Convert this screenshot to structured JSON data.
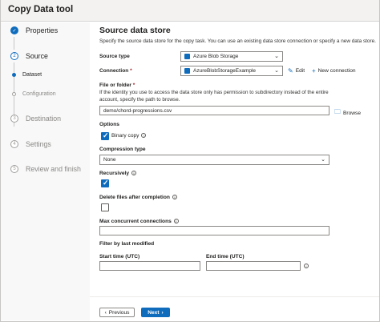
{
  "window": {
    "title": "Copy Data tool"
  },
  "sidebar": {
    "steps": [
      {
        "label": "Properties",
        "number": "",
        "state": "done"
      },
      {
        "label": "Source",
        "number": "2",
        "state": "active"
      },
      {
        "label": "Destination",
        "number": "3",
        "state": "inactive"
      },
      {
        "label": "Settings",
        "number": "4",
        "state": "inactive"
      },
      {
        "label": "Review and finish",
        "number": "5",
        "state": "inactive"
      }
    ],
    "substeps": [
      {
        "label": "Dataset",
        "state": "active"
      },
      {
        "label": "Configuration",
        "state": "inactive"
      }
    ]
  },
  "main": {
    "title": "Source data store",
    "description": "Specify the source data store for the copy task. You can use an existing data store connection or specify a new data store.",
    "source_type": {
      "label": "Source type",
      "value": "Azure Blob Storage"
    },
    "connection": {
      "label": "Connection",
      "required_mark": "*",
      "value": "AzureBlobStorageExample",
      "edit_label": "Edit",
      "new_label": "New connection"
    },
    "file_or_folder": {
      "label": "File or folder",
      "required_mark": "*",
      "help": "If the identity you use to access the data store only has permission to subdirectory instead of the entire account, specify the path to browse.",
      "value": "demo/chord-progressions.csv",
      "browse_label": "Browse"
    },
    "options": {
      "label": "Options",
      "binary_copy": {
        "label": "Binary copy",
        "checked": true
      }
    },
    "compression_type": {
      "label": "Compression type",
      "value": "None"
    },
    "recursively": {
      "label": "Recursively",
      "checked": true
    },
    "delete_after": {
      "label": "Delete files after completion",
      "checked": false
    },
    "max_connections": {
      "label": "Max concurrent connections",
      "value": ""
    },
    "filter": {
      "label": "Filter by last modified",
      "start_label": "Start time (UTC)",
      "end_label": "End time (UTC)",
      "start_value": "",
      "end_value": ""
    }
  },
  "footer": {
    "previous_label": "Previous",
    "next_label": "Next"
  },
  "colors": {
    "accent": "#0f6cbd",
    "required": "#a4262c"
  },
  "icons": {
    "done": "checkmark-icon",
    "chevron": "chevron-down-icon",
    "edit": "pencil-icon",
    "add": "plus-icon",
    "browse": "folder-icon",
    "info": "info-icon"
  }
}
